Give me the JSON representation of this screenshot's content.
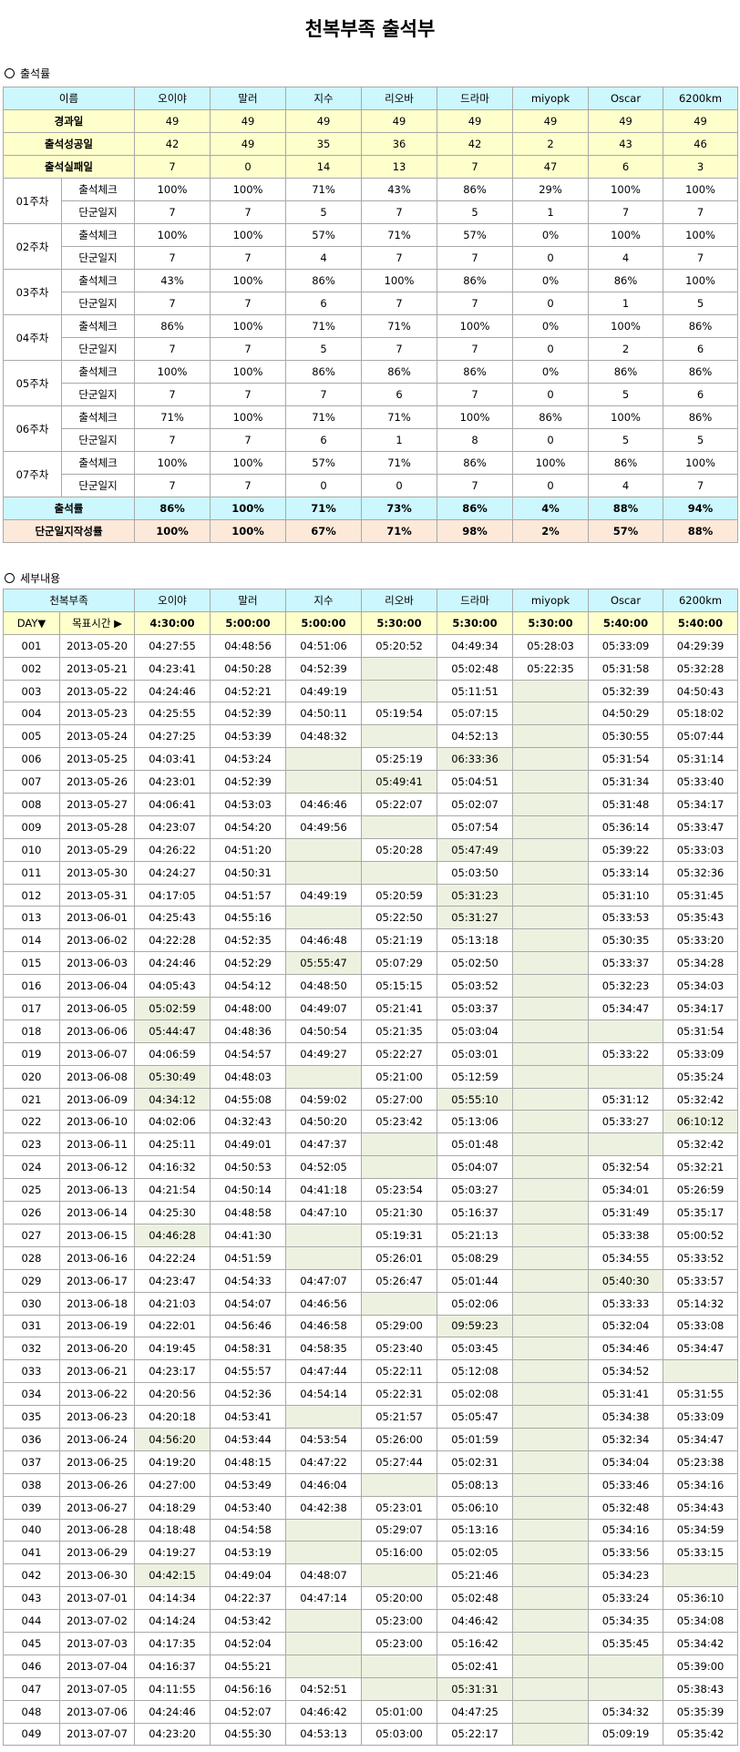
{
  "title": "천복부족 출석부",
  "section1_title": "출석률",
  "section2_title": "세부내용",
  "members": [
    "오이야",
    "말러",
    "지수",
    "리오바",
    "드라마",
    "miyopk",
    "Oscar",
    "6200km"
  ],
  "summary": {
    "header_label": "이름",
    "rows": [
      {
        "label": "경과일",
        "values": [
          "49",
          "49",
          "49",
          "49",
          "49",
          "49",
          "49",
          "49"
        ]
      },
      {
        "label": "출석성공일",
        "values": [
          "42",
          "49",
          "35",
          "36",
          "42",
          "2",
          "43",
          "46"
        ]
      },
      {
        "label": "출석실패일",
        "values": [
          "7",
          "0",
          "14",
          "13",
          "7",
          "47",
          "6",
          "3"
        ]
      }
    ],
    "check_label": "출석체크",
    "diary_label": "단군일지",
    "weeks": [
      {
        "week": "01주차",
        "check": [
          "100%",
          "100%",
          "71%",
          "43%",
          "86%",
          "29%",
          "100%",
          "100%"
        ],
        "diary": [
          "7",
          "7",
          "5",
          "7",
          "5",
          "1",
          "7",
          "7"
        ]
      },
      {
        "week": "02주차",
        "check": [
          "100%",
          "100%",
          "57%",
          "71%",
          "57%",
          "0%",
          "100%",
          "100%"
        ],
        "diary": [
          "7",
          "7",
          "4",
          "7",
          "7",
          "0",
          "4",
          "7"
        ]
      },
      {
        "week": "03주차",
        "check": [
          "43%",
          "100%",
          "86%",
          "100%",
          "86%",
          "0%",
          "86%",
          "100%"
        ],
        "diary": [
          "7",
          "7",
          "6",
          "7",
          "7",
          "0",
          "1",
          "5"
        ]
      },
      {
        "week": "04주차",
        "check": [
          "86%",
          "100%",
          "71%",
          "71%",
          "100%",
          "0%",
          "100%",
          "86%"
        ],
        "diary": [
          "7",
          "7",
          "5",
          "7",
          "7",
          "0",
          "2",
          "6"
        ]
      },
      {
        "week": "05주차",
        "check": [
          "100%",
          "100%",
          "86%",
          "86%",
          "86%",
          "0%",
          "86%",
          "86%"
        ],
        "diary": [
          "7",
          "7",
          "7",
          "6",
          "7",
          "0",
          "5",
          "6"
        ]
      },
      {
        "week": "06주차",
        "check": [
          "71%",
          "100%",
          "71%",
          "71%",
          "100%",
          "86%",
          "100%",
          "86%"
        ],
        "diary": [
          "7",
          "7",
          "6",
          "1",
          "8",
          "0",
          "5",
          "5"
        ]
      },
      {
        "week": "07주차",
        "check": [
          "100%",
          "100%",
          "57%",
          "71%",
          "86%",
          "100%",
          "86%",
          "100%"
        ],
        "diary": [
          "7",
          "7",
          "0",
          "0",
          "7",
          "0",
          "4",
          "7"
        ]
      }
    ],
    "rate": {
      "label": "출석률",
      "values": [
        "86%",
        "100%",
        "71%",
        "73%",
        "86%",
        "4%",
        "88%",
        "94%"
      ]
    },
    "completion": {
      "label": "단군일지작성률",
      "values": [
        "100%",
        "100%",
        "67%",
        "71%",
        "98%",
        "2%",
        "57%",
        "88%"
      ]
    }
  },
  "detail": {
    "header_label": "천복부족",
    "day_label": "DAY▼",
    "target_label": "목표시간 ▶",
    "targets": [
      "4:30:00",
      "5:00:00",
      "5:00:00",
      "5:30:00",
      "5:30:00",
      "5:30:00",
      "5:40:00",
      "5:40:00"
    ],
    "rows": [
      [
        "001",
        "2013-05-20",
        "04:27:55",
        "04:48:56",
        "04:51:06",
        "05:20:52",
        "04:49:34",
        "05:28:03",
        "05:33:09",
        "04:29:39"
      ],
      [
        "002",
        "2013-05-21",
        "04:23:41",
        "04:50:28",
        "04:52:39",
        "",
        "05:02:48",
        "05:22:35",
        "05:31:58",
        "05:32:28"
      ],
      [
        "003",
        "2013-05-22",
        "04:24:46",
        "04:52:21",
        "04:49:19",
        "",
        "05:11:51",
        "",
        "05:32:39",
        "04:50:43"
      ],
      [
        "004",
        "2013-05-23",
        "04:25:55",
        "04:52:39",
        "04:50:11",
        "05:19:54",
        "05:07:15",
        "",
        "04:50:29",
        "05:18:02"
      ],
      [
        "005",
        "2013-05-24",
        "04:27:25",
        "04:53:39",
        "04:48:32",
        "",
        "04:52:13",
        "",
        "05:30:55",
        "05:07:44"
      ],
      [
        "006",
        "2013-05-25",
        "04:03:41",
        "04:53:24",
        "",
        "05:25:19",
        "06:33:36",
        "",
        "05:31:54",
        "05:31:14"
      ],
      [
        "007",
        "2013-05-26",
        "04:23:01",
        "04:52:39",
        "",
        "05:49:41",
        "05:04:51",
        "",
        "05:31:34",
        "05:33:40"
      ],
      [
        "008",
        "2013-05-27",
        "04:06:41",
        "04:53:03",
        "04:46:46",
        "05:22:07",
        "05:02:07",
        "",
        "05:31:48",
        "05:34:17"
      ],
      [
        "009",
        "2013-05-28",
        "04:23:07",
        "04:54:20",
        "04:49:56",
        "",
        "05:07:54",
        "",
        "05:36:14",
        "05:33:47"
      ],
      [
        "010",
        "2013-05-29",
        "04:26:22",
        "04:51:20",
        "",
        "05:20:28",
        "05:47:49",
        "",
        "05:39:22",
        "05:33:03"
      ],
      [
        "011",
        "2013-05-30",
        "04:24:27",
        "04:50:31",
        "",
        "",
        "05:03:50",
        "",
        "05:33:14",
        "05:32:36"
      ],
      [
        "012",
        "2013-05-31",
        "04:17:05",
        "04:51:57",
        "04:49:19",
        "05:20:59",
        "05:31:23",
        "",
        "05:31:10",
        "05:31:45"
      ],
      [
        "013",
        "2013-06-01",
        "04:25:43",
        "04:55:16",
        "",
        "05:22:50",
        "05:31:27",
        "",
        "05:33:53",
        "05:35:43"
      ],
      [
        "014",
        "2013-06-02",
        "04:22:28",
        "04:52:35",
        "04:46:48",
        "05:21:19",
        "05:13:18",
        "",
        "05:30:35",
        "05:33:20"
      ],
      [
        "015",
        "2013-06-03",
        "04:24:46",
        "04:52:29",
        "05:55:47",
        "05:07:29",
        "05:02:50",
        "",
        "05:33:37",
        "05:34:28"
      ],
      [
        "016",
        "2013-06-04",
        "04:05:43",
        "04:54:12",
        "04:48:50",
        "05:15:15",
        "05:03:52",
        "",
        "05:32:23",
        "05:34:03"
      ],
      [
        "017",
        "2013-06-05",
        "05:02:59",
        "04:48:00",
        "04:49:07",
        "05:21:41",
        "05:03:37",
        "",
        "05:34:47",
        "05:34:17"
      ],
      [
        "018",
        "2013-06-06",
        "05:44:47",
        "04:48:36",
        "04:50:54",
        "05:21:35",
        "05:03:04",
        "",
        "",
        "05:31:54"
      ],
      [
        "019",
        "2013-06-07",
        "04:06:59",
        "04:54:57",
        "04:49:27",
        "05:22:27",
        "05:03:01",
        "",
        "05:33:22",
        "05:33:09"
      ],
      [
        "020",
        "2013-06-08",
        "05:30:49",
        "04:48:03",
        "",
        "05:21:00",
        "05:12:59",
        "",
        "",
        "05:35:24"
      ],
      [
        "021",
        "2013-06-09",
        "04:34:12",
        "04:55:08",
        "04:59:02",
        "05:27:00",
        "05:55:10",
        "",
        "05:31:12",
        "05:32:42"
      ],
      [
        "022",
        "2013-06-10",
        "04:02:06",
        "04:32:43",
        "04:50:20",
        "05:23:42",
        "05:13:06",
        "",
        "05:33:27",
        "06:10:12"
      ],
      [
        "023",
        "2013-06-11",
        "04:25:11",
        "04:49:01",
        "04:47:37",
        "",
        "05:01:48",
        "",
        "",
        "05:32:42"
      ],
      [
        "024",
        "2013-06-12",
        "04:16:32",
        "04:50:53",
        "04:52:05",
        "",
        "05:04:07",
        "",
        "05:32:54",
        "05:32:21"
      ],
      [
        "025",
        "2013-06-13",
        "04:21:54",
        "04:50:14",
        "04:41:18",
        "05:23:54",
        "05:03:27",
        "",
        "05:34:01",
        "05:26:59"
      ],
      [
        "026",
        "2013-06-14",
        "04:25:30",
        "04:48:58",
        "04:47:10",
        "05:21:30",
        "05:16:37",
        "",
        "05:31:49",
        "05:35:17"
      ],
      [
        "027",
        "2013-06-15",
        "04:46:28",
        "04:41:30",
        "",
        "05:19:31",
        "05:21:13",
        "",
        "05:33:38",
        "05:00:52"
      ],
      [
        "028",
        "2013-06-16",
        "04:22:24",
        "04:51:59",
        "",
        "05:26:01",
        "05:08:29",
        "",
        "05:34:55",
        "05:33:52"
      ],
      [
        "029",
        "2013-06-17",
        "04:23:47",
        "04:54:33",
        "04:47:07",
        "05:26:47",
        "05:01:44",
        "",
        "05:40:30",
        "05:33:57"
      ],
      [
        "030",
        "2013-06-18",
        "04:21:03",
        "04:54:07",
        "04:46:56",
        "",
        "05:02:06",
        "",
        "05:33:33",
        "05:14:32"
      ],
      [
        "031",
        "2013-06-19",
        "04:22:01",
        "04:56:46",
        "04:46:58",
        "05:29:00",
        "09:59:23",
        "",
        "05:32:04",
        "05:33:08"
      ],
      [
        "032",
        "2013-06-20",
        "04:19:45",
        "04:58:31",
        "04:58:35",
        "05:23:40",
        "05:03:45",
        "",
        "05:34:46",
        "05:34:47"
      ],
      [
        "033",
        "2013-06-21",
        "04:23:17",
        "04:55:57",
        "04:47:44",
        "05:22:11",
        "05:12:08",
        "",
        "05:34:52",
        ""
      ],
      [
        "034",
        "2013-06-22",
        "04:20:56",
        "04:52:36",
        "04:54:14",
        "05:22:31",
        "05:02:08",
        "",
        "05:31:41",
        "05:31:55"
      ],
      [
        "035",
        "2013-06-23",
        "04:20:18",
        "04:53:41",
        "",
        "05:21:57",
        "05:05:47",
        "",
        "05:34:38",
        "05:33:09"
      ],
      [
        "036",
        "2013-06-24",
        "04:56:20",
        "04:53:44",
        "04:53:54",
        "05:26:00",
        "05:01:59",
        "",
        "05:32:34",
        "05:34:47"
      ],
      [
        "037",
        "2013-06-25",
        "04:19:20",
        "04:48:15",
        "04:47:22",
        "05:27:44",
        "05:02:31",
        "",
        "05:34:04",
        "05:23:38"
      ],
      [
        "038",
        "2013-06-26",
        "04:27:00",
        "04:53:49",
        "04:46:04",
        "",
        "05:08:13",
        "",
        "05:33:46",
        "05:34:16"
      ],
      [
        "039",
        "2013-06-27",
        "04:18:29",
        "04:53:40",
        "04:42:38",
        "05:23:01",
        "05:06:10",
        "",
        "05:32:48",
        "05:34:43"
      ],
      [
        "040",
        "2013-06-28",
        "04:18:48",
        "04:54:58",
        "",
        "05:29:07",
        "05:13:16",
        "",
        "05:34:16",
        "05:34:59"
      ],
      [
        "041",
        "2013-06-29",
        "04:19:27",
        "04:53:19",
        "",
        "05:16:00",
        "05:02:05",
        "",
        "05:33:56",
        "05:33:15"
      ],
      [
        "042",
        "2013-06-30",
        "04:42:15",
        "04:49:04",
        "04:48:07",
        "",
        "05:21:46",
        "",
        "05:34:23",
        ""
      ],
      [
        "043",
        "2013-07-01",
        "04:14:34",
        "04:22:37",
        "04:47:14",
        "05:20:00",
        "05:02:48",
        "",
        "05:33:24",
        "05:36:10"
      ],
      [
        "044",
        "2013-07-02",
        "04:14:24",
        "04:53:42",
        "",
        "05:23:00",
        "04:46:42",
        "",
        "05:34:35",
        "05:34:08"
      ],
      [
        "045",
        "2013-07-03",
        "04:17:35",
        "04:52:04",
        "",
        "05:23:00",
        "05:16:42",
        "",
        "05:35:45",
        "05:34:42"
      ],
      [
        "046",
        "2013-07-04",
        "04:16:37",
        "04:55:21",
        "",
        "",
        "05:02:41",
        "",
        "",
        "05:39:00"
      ],
      [
        "047",
        "2013-07-05",
        "04:11:55",
        "04:56:16",
        "04:52:51",
        "",
        "05:31:31",
        "",
        "",
        "05:38:43"
      ],
      [
        "048",
        "2013-07-06",
        "04:24:46",
        "04:52:07",
        "04:46:42",
        "05:01:00",
        "04:47:25",
        "",
        "05:34:32",
        "05:35:39"
      ],
      [
        "049",
        "2013-07-07",
        "04:23:20",
        "04:55:30",
        "04:53:13",
        "05:03:00",
        "05:22:17",
        "",
        "05:09:19",
        "05:35:42"
      ]
    ]
  }
}
